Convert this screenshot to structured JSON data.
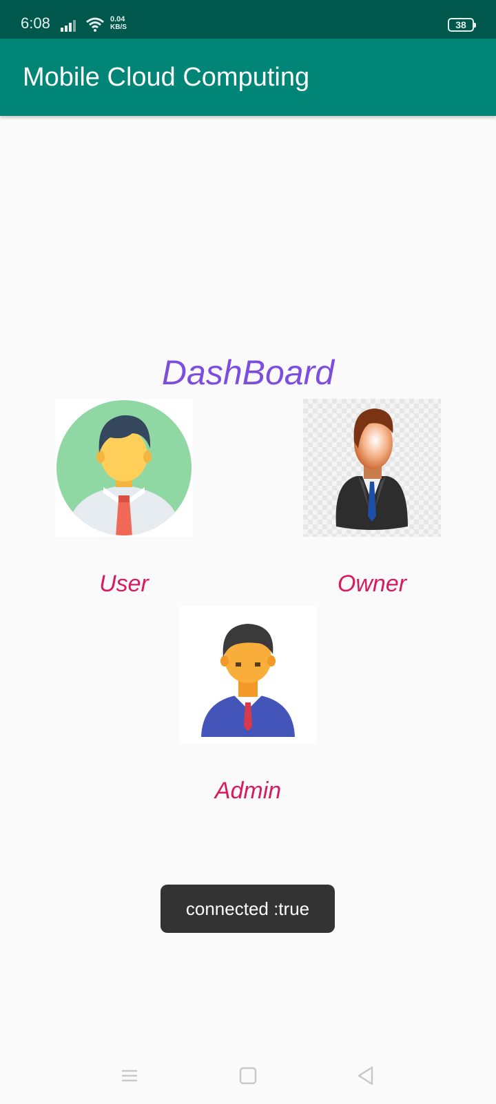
{
  "status_bar": {
    "time": "6:08",
    "net_speed_value": "0.04",
    "net_speed_unit": "KB/S",
    "battery": "38",
    "icons": [
      "signal-icon",
      "wifi-icon",
      "battery-icon"
    ]
  },
  "app_bar": {
    "title": "Mobile Cloud Computing",
    "color": "#008577"
  },
  "dashboard": {
    "title": "DashBoard",
    "title_color": "#7c4ddf",
    "label_color": "#d81b60",
    "tiles": [
      {
        "label": "User",
        "icon": "user-avatar-icon"
      },
      {
        "label": "Owner",
        "icon": "owner-avatar-icon"
      },
      {
        "label": "Admin",
        "icon": "admin-avatar-icon"
      }
    ]
  },
  "toast": {
    "text": "connected :true"
  },
  "nav_bar": {
    "icons": [
      "menu-icon",
      "home-icon",
      "back-icon"
    ]
  }
}
